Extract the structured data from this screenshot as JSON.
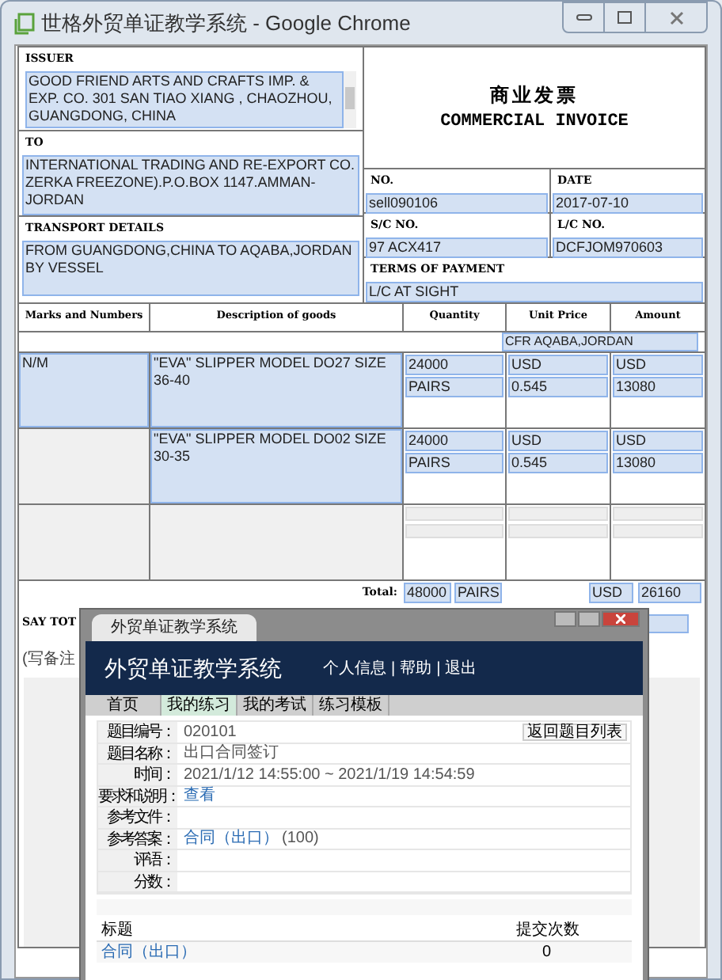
{
  "window": {
    "title": "世格外贸单证教学系统 - Google Chrome"
  },
  "invoice": {
    "issuer": {
      "label": "ISSUER",
      "value": "GOOD FRIEND ARTS AND CRAFTS IMP. & EXP. CO. 301 SAN TIAO XIANG , CHAOZHOU, GUANGDONG, CHINA"
    },
    "to": {
      "label": "TO",
      "value": "INTERNATIONAL TRADING AND RE-EXPORT CO. ZERKA FREEZONE).P.O.BOX 1147.AMMAN-JORDAN"
    },
    "transport": {
      "label": "TRANSPORT DETAILS",
      "value": "FROM GUANGDONG,CHINA TO AQABA,JORDAN BY VESSEL"
    },
    "title_cn": "商业发票",
    "title_en": "COMMERCIAL INVOICE",
    "no": {
      "label": "NO.",
      "value": "sell090106"
    },
    "date": {
      "label": "DATE",
      "value": "2017-07-10"
    },
    "sc_no": {
      "label": "S/C NO.",
      "value": "97 ACX417"
    },
    "lc_no": {
      "label": "L/C NO.",
      "value": "DCFJOM970603"
    },
    "terms": {
      "label": "TERMS OF PAYMENT",
      "value": "L/C AT SIGHT"
    }
  },
  "goods": {
    "columns": [
      "Marks and Numbers",
      "Description of goods",
      "Quantity",
      "Unit Price",
      "Amount"
    ],
    "price_term": "CFR AQABA,JORDAN",
    "rows": [
      {
        "kind": "item",
        "marks": "N/M",
        "description": "\"EVA\" SLIPPER MODEL DO27 SIZE 36-40",
        "quantity": "24000",
        "unit": "PAIRS",
        "currency": "USD",
        "unit_price": "0.545",
        "amount_currency": "USD",
        "amount": "13080"
      },
      {
        "kind": "item",
        "description": "\"EVA\" SLIPPER MODEL DO02 SIZE 30-35",
        "quantity": "24000",
        "unit": "PAIRS",
        "currency": "USD",
        "unit_price": "0.545",
        "amount_currency": "USD",
        "amount": "13080"
      },
      {
        "kind": "blank"
      }
    ],
    "total": {
      "label": "Total:",
      "quantity": "48000",
      "unit": "PAIRS",
      "currency": "USD",
      "amount": "26160"
    }
  },
  "say_total": "SAY TOT",
  "note": "(写备注",
  "popup": {
    "tab_title": "外贸单证教学系统",
    "app_title": "外贸单证教学系统",
    "links": [
      "个人信息",
      "帮助",
      "退出"
    ],
    "separator": "|",
    "nav": [
      {
        "label": "首页",
        "selected": false
      },
      {
        "label": "我的练习",
        "selected": true
      },
      {
        "label": "我的考试",
        "selected": false
      },
      {
        "label": "练习模板",
        "selected": false
      }
    ],
    "back_button": "返回题目列表",
    "fields": [
      {
        "label": "题目编号：",
        "kind": "text",
        "value": "020101"
      },
      {
        "label": "题目名称：",
        "kind": "text",
        "value": "出口合同签订"
      },
      {
        "label": "时间：",
        "kind": "text",
        "value": "2021/1/12 14:55:00 ~ 2021/1/19 14:54:59"
      },
      {
        "label": "要求和说明：",
        "kind": "link",
        "value": "查看"
      },
      {
        "label": "参考文件：",
        "kind": "empty"
      },
      {
        "label": "参考答案：",
        "kind": "link",
        "value": "合同（出口）",
        "note": "(100)"
      },
      {
        "label": "评语：",
        "kind": "empty"
      },
      {
        "label": "分数：",
        "kind": "empty"
      }
    ],
    "table": {
      "columns": [
        "标题",
        "提交次数"
      ],
      "rows": [
        {
          "title": "合同（出口）",
          "count": "0"
        }
      ]
    }
  }
}
